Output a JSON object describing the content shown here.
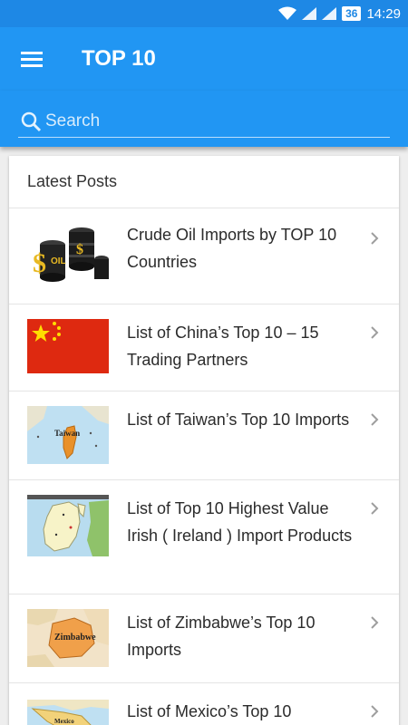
{
  "status": {
    "battery": "36",
    "time": "14:29"
  },
  "appbar": {
    "title": "TOP 10",
    "menu_icon": "hamburger-menu-icon"
  },
  "search": {
    "placeholder": "Search"
  },
  "colors": {
    "primary": "#2196f3",
    "status_bar": "#1e88e5"
  },
  "section": {
    "title": "Latest Posts"
  },
  "posts": [
    {
      "title": "Crude Oil Imports by TOP 10 Countries",
      "thumb": "oil-barrels"
    },
    {
      "title": "List of China’s Top 10 – 15 Trading Partners",
      "thumb": "china-flag"
    },
    {
      "title": "List of Taiwan’s Top 10 Imports",
      "thumb": "taiwan-map",
      "map_label": "Taiwan"
    },
    {
      "title": "List of Top 10 Highest Value Irish ( Ireland ) Import Products",
      "thumb": "ireland-map"
    },
    {
      "title": "List of Zimbabwe’s Top 10 Imports",
      "thumb": "zimbabwe-map",
      "map_label": "Zimbabwe"
    },
    {
      "title": "List of Mexico’s Top 10",
      "thumb": "mexico-map",
      "map_label": "Mexico"
    }
  ]
}
